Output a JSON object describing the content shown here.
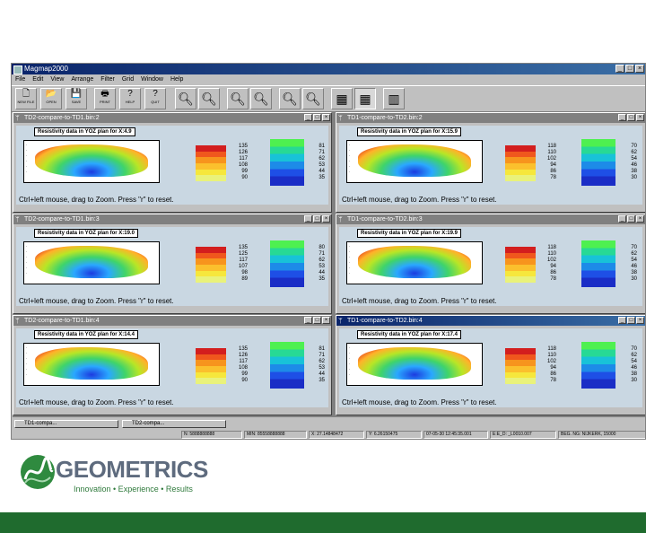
{
  "app": {
    "title": "Magmap2000",
    "menu": [
      "File",
      "Edit",
      "View",
      "Arrange",
      "Filter",
      "Grid",
      "Window",
      "Help"
    ],
    "toolbar": [
      {
        "glyph": "🗋",
        "label": "NEW FILE"
      },
      {
        "glyph": "📂",
        "label": "OPEN"
      },
      {
        "glyph": "💾",
        "label": "SAVE"
      },
      {
        "glyph": "🖶",
        "label": "PRINT"
      },
      {
        "glyph": "?",
        "label": "HELP"
      },
      {
        "glyph": "?",
        "label": "QUIT"
      },
      {
        "glyph": "🔍︎"
      },
      {
        "glyph": "🔍︎"
      },
      {
        "glyph": "🔍︎"
      },
      {
        "glyph": "🔍︎"
      },
      {
        "glyph": "🔍︎"
      },
      {
        "glyph": "🔍︎"
      },
      {
        "glyph": "▦"
      },
      {
        "glyph": "▦"
      },
      {
        "glyph": "▥"
      }
    ]
  },
  "windows": [
    {
      "title": "TD2-compare-to-TD1.bin:2",
      "plot_title": "Resistivity data in YOZ plan for X:4.9",
      "warm": [
        "135",
        "126",
        "117",
        "108",
        "99",
        "90"
      ],
      "cool": [
        "81",
        "71",
        "62",
        "53",
        "44",
        "35"
      ],
      "hint": "Ctrl+left mouse, drag to Zoom. Press \"r\" to reset.",
      "active": false
    },
    {
      "title": "TD1-compare-to-TD2.bin:2",
      "plot_title": "Resistivity data in YOZ plan for X:15.9",
      "warm": [
        "118",
        "110",
        "102",
        "94",
        "86",
        "78"
      ],
      "cool": [
        "70",
        "62",
        "54",
        "46",
        "38",
        "30"
      ],
      "hint": "Ctrl+left mouse, drag to Zoom. Press \"r\" to reset.",
      "active": false
    },
    {
      "title": "TD2-compare-to-TD1.bin:3",
      "plot_title": "Resistivity data in YOZ plan for X:19.0",
      "warm": [
        "135",
        "125",
        "117",
        "107",
        "98",
        "89"
      ],
      "cool": [
        "80",
        "71",
        "62",
        "53",
        "44",
        "35"
      ],
      "hint": "Ctrl+left mouse, drag to Zoom. Press \"r\" to reset.",
      "active": false
    },
    {
      "title": "TD1-compare-to-TD2.bin:3",
      "plot_title": "Resistivity data in YOZ plan for X:19.9",
      "warm": [
        "118",
        "110",
        "102",
        "94",
        "86",
        "78"
      ],
      "cool": [
        "70",
        "62",
        "54",
        "46",
        "38",
        "30"
      ],
      "hint": "Ctrl+left mouse, drag to Zoom. Press \"r\" to reset.",
      "active": false
    },
    {
      "title": "TD2-compare-to-TD1.bin:4",
      "plot_title": "Resistivity data in YOZ plan for X:14.4",
      "warm": [
        "135",
        "126",
        "117",
        "108",
        "99",
        "90"
      ],
      "cool": [
        "81",
        "71",
        "62",
        "53",
        "44",
        "35"
      ],
      "hint": "Ctrl+left mouse, drag to Zoom. Press \"r\" to reset.",
      "active": false
    },
    {
      "title": "TD1-compare-to-TD2.bin:4",
      "plot_title": "Resistivity data in YOZ plan for X:17.4",
      "warm": [
        "118",
        "110",
        "102",
        "94",
        "86",
        "78"
      ],
      "cool": [
        "70",
        "62",
        "54",
        "46",
        "38",
        "30"
      ],
      "hint": "Ctrl+left mouse, drag to Zoom. Press \"r\" to reset.",
      "active": true
    }
  ],
  "taskbar": [
    "TD1-compa...",
    "TD2-compa..."
  ],
  "status": [
    "N: 5888888888",
    "MIN: 85558888888",
    "X: 27.14848472",
    "Y: 6.26150475",
    "07-05-30 12:45:35.001",
    "E:E_D: _L0010.007",
    "BEG. NG: NIJKERK, 15000"
  ],
  "brand": {
    "name": "GEOMETRICS",
    "tagline": "Innovation • Experience • Results"
  }
}
